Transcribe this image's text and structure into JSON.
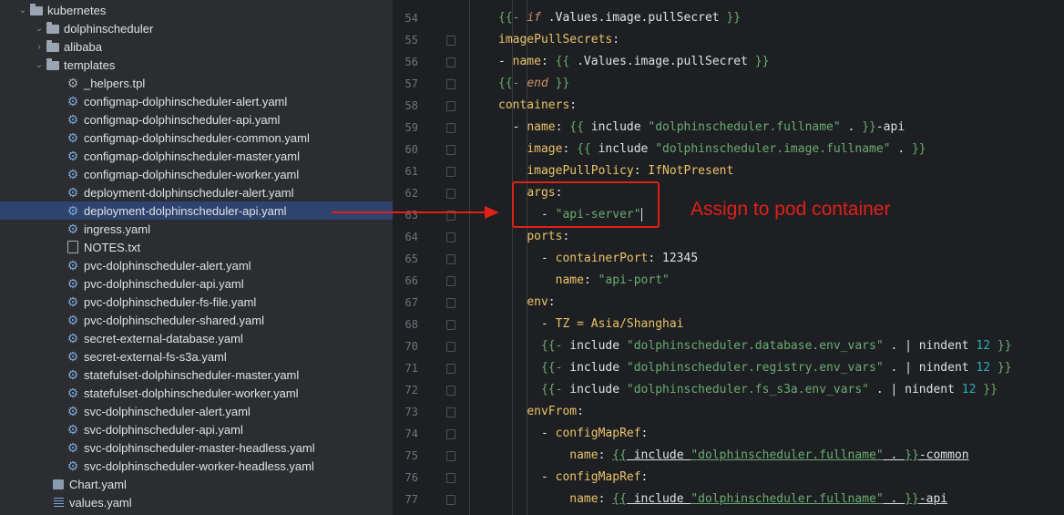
{
  "tree": {
    "items": [
      {
        "label": "kubernetes",
        "icon": "folder-icon"
      },
      {
        "label": "dolphinscheduler",
        "icon": "folder-icon"
      },
      {
        "label": "alibaba",
        "icon": "folder-icon"
      },
      {
        "label": "templates",
        "icon": "folder-icon"
      },
      {
        "label": "_helpers.tpl",
        "icon": "gear-icon"
      },
      {
        "label": "configmap-dolphinscheduler-alert.yaml",
        "icon": "gear-icon"
      },
      {
        "label": "configmap-dolphinscheduler-api.yaml",
        "icon": "gear-icon"
      },
      {
        "label": "configmap-dolphinscheduler-common.yaml",
        "icon": "gear-icon"
      },
      {
        "label": "configmap-dolphinscheduler-master.yaml",
        "icon": "gear-icon"
      },
      {
        "label": "configmap-dolphinscheduler-worker.yaml",
        "icon": "gear-icon"
      },
      {
        "label": "deployment-dolphinscheduler-alert.yaml",
        "icon": "gear-icon"
      },
      {
        "label": "deployment-dolphinscheduler-api.yaml",
        "icon": "gear-icon"
      },
      {
        "label": "ingress.yaml",
        "icon": "gear-icon"
      },
      {
        "label": "NOTES.txt",
        "icon": "text-file-icon"
      },
      {
        "label": "pvc-dolphinscheduler-alert.yaml",
        "icon": "gear-icon"
      },
      {
        "label": "pvc-dolphinscheduler-api.yaml",
        "icon": "gear-icon"
      },
      {
        "label": "pvc-dolphinscheduler-fs-file.yaml",
        "icon": "gear-icon"
      },
      {
        "label": "pvc-dolphinscheduler-shared.yaml",
        "icon": "gear-icon"
      },
      {
        "label": "secret-external-database.yaml",
        "icon": "gear-icon"
      },
      {
        "label": "secret-external-fs-s3a.yaml",
        "icon": "gear-icon"
      },
      {
        "label": "statefulset-dolphinscheduler-master.yaml",
        "icon": "gear-icon"
      },
      {
        "label": "statefulset-dolphinscheduler-worker.yaml",
        "icon": "gear-icon"
      },
      {
        "label": "svc-dolphinscheduler-alert.yaml",
        "icon": "gear-icon"
      },
      {
        "label": "svc-dolphinscheduler-api.yaml",
        "icon": "gear-icon"
      },
      {
        "label": "svc-dolphinscheduler-master-headless.yaml",
        "icon": "gear-icon"
      },
      {
        "label": "svc-dolphinscheduler-worker-headless.yaml",
        "icon": "gear-icon"
      },
      {
        "label": "Chart.yaml",
        "icon": "chart-file-icon"
      },
      {
        "label": "values.yaml",
        "icon": "list-file-icon"
      }
    ],
    "selected": "deployment-dolphinscheduler-api.yaml"
  },
  "editor": {
    "lines": [
      {
        "n": "54",
        "tokens": [
          {
            "c": "br",
            "t": "{{- "
          },
          {
            "c": "i",
            "t": "if"
          },
          {
            "c": "p",
            "t": " .Values.image.pullSecret "
          },
          {
            "c": "br",
            "t": "}}"
          }
        ]
      },
      {
        "n": "55",
        "tokens": [
          {
            "c": "t",
            "t": "imagePullSecrets"
          },
          {
            "c": "p",
            "t": ":"
          }
        ]
      },
      {
        "n": "56",
        "tokens": [
          {
            "c": "p",
            "t": "- "
          },
          {
            "c": "t",
            "t": "name"
          },
          {
            "c": "p",
            "t": ": "
          },
          {
            "c": "br",
            "t": "{{"
          },
          {
            "c": "p",
            "t": " .Values.image.pullSecret "
          },
          {
            "c": "br",
            "t": "}}"
          }
        ]
      },
      {
        "n": "57",
        "tokens": [
          {
            "c": "br",
            "t": "{{- "
          },
          {
            "c": "i",
            "t": "end"
          },
          {
            "c": "br",
            "t": " }}"
          }
        ]
      },
      {
        "n": "58",
        "tokens": [
          {
            "c": "t",
            "t": "containers"
          },
          {
            "c": "p",
            "t": ":"
          }
        ]
      },
      {
        "n": "59",
        "tokens": [
          {
            "c": "p",
            "t": "  - "
          },
          {
            "c": "t",
            "t": "name"
          },
          {
            "c": "p",
            "t": ": "
          },
          {
            "c": "br",
            "t": "{{"
          },
          {
            "c": "p",
            "t": " include "
          },
          {
            "c": "s",
            "t": "\"dolphinscheduler.fullname\""
          },
          {
            "c": "p",
            "t": " . "
          },
          {
            "c": "br",
            "t": "}}"
          },
          {
            "c": "p",
            "t": "-api"
          }
        ]
      },
      {
        "n": "60",
        "tokens": [
          {
            "c": "p",
            "t": "    "
          },
          {
            "c": "t",
            "t": "image"
          },
          {
            "c": "p",
            "t": ": "
          },
          {
            "c": "br",
            "t": "{{"
          },
          {
            "c": "p",
            "t": " include "
          },
          {
            "c": "s",
            "t": "\"dolphinscheduler.image.fullname\""
          },
          {
            "c": "p",
            "t": " . "
          },
          {
            "c": "br",
            "t": "}}"
          }
        ]
      },
      {
        "n": "61",
        "tokens": [
          {
            "c": "p",
            "t": "    "
          },
          {
            "c": "t",
            "t": "imagePullPolicy"
          },
          {
            "c": "p",
            "t": ": "
          },
          {
            "c": "t",
            "t": "IfNotPresent"
          }
        ]
      },
      {
        "n": "62",
        "tokens": [
          {
            "c": "p",
            "t": "    "
          },
          {
            "c": "t",
            "t": "args"
          },
          {
            "c": "p",
            "t": ":"
          }
        ]
      },
      {
        "n": "63",
        "tokens": [
          {
            "c": "p",
            "t": "      - "
          },
          {
            "c": "s",
            "t": "\"api-server\""
          }
        ]
      },
      {
        "n": "64",
        "tokens": [
          {
            "c": "p",
            "t": "    "
          },
          {
            "c": "t",
            "t": "ports"
          },
          {
            "c": "p",
            "t": ":"
          }
        ]
      },
      {
        "n": "65",
        "tokens": [
          {
            "c": "p",
            "t": "      - "
          },
          {
            "c": "t",
            "t": "containerPort"
          },
          {
            "c": "p",
            "t": ": 12345"
          }
        ]
      },
      {
        "n": "66",
        "tokens": [
          {
            "c": "p",
            "t": "        "
          },
          {
            "c": "t",
            "t": "name"
          },
          {
            "c": "p",
            "t": ": "
          },
          {
            "c": "s",
            "t": "\"api-port\""
          }
        ]
      },
      {
        "n": "67",
        "tokens": [
          {
            "c": "p",
            "t": "    "
          },
          {
            "c": "t",
            "t": "env"
          },
          {
            "c": "p",
            "t": ":"
          }
        ]
      },
      {
        "n": "68",
        "tokens": [
          {
            "c": "p",
            "t": "      - "
          },
          {
            "c": "t",
            "t": "TZ = Asia/Shanghai"
          }
        ]
      },
      {
        "n": "70",
        "tokens": [
          {
            "c": "p",
            "t": "      "
          },
          {
            "c": "br",
            "t": "{{-"
          },
          {
            "c": "p",
            "t": " include "
          },
          {
            "c": "s",
            "t": "\"dolphinscheduler.database.env_vars\""
          },
          {
            "c": "p",
            "t": " . | nindent "
          },
          {
            "c": "n",
            "t": "12"
          },
          {
            "c": "br",
            "t": " }}"
          }
        ]
      },
      {
        "n": "71",
        "tokens": [
          {
            "c": "p",
            "t": "      "
          },
          {
            "c": "br",
            "t": "{{-"
          },
          {
            "c": "p",
            "t": " include "
          },
          {
            "c": "s",
            "t": "\"dolphinscheduler.registry.env_vars\""
          },
          {
            "c": "p",
            "t": " . | nindent "
          },
          {
            "c": "n",
            "t": "12"
          },
          {
            "c": "br",
            "t": " }}"
          }
        ]
      },
      {
        "n": "72",
        "tokens": [
          {
            "c": "p",
            "t": "      "
          },
          {
            "c": "br",
            "t": "{{-"
          },
          {
            "c": "p",
            "t": " include "
          },
          {
            "c": "s",
            "t": "\"dolphinscheduler.fs_s3a.env_vars\""
          },
          {
            "c": "p",
            "t": " . | nindent "
          },
          {
            "c": "n",
            "t": "12"
          },
          {
            "c": "br",
            "t": " }}"
          }
        ]
      },
      {
        "n": "73",
        "tokens": [
          {
            "c": "p",
            "t": "    "
          },
          {
            "c": "t",
            "t": "envFrom"
          },
          {
            "c": "p",
            "t": ":"
          }
        ]
      },
      {
        "n": "74",
        "tokens": [
          {
            "c": "p",
            "t": "      - "
          },
          {
            "c": "t",
            "t": "configMapRef"
          },
          {
            "c": "p",
            "t": ":"
          }
        ]
      },
      {
        "n": "75",
        "tokens": [
          {
            "c": "p",
            "t": "          "
          },
          {
            "c": "t",
            "t": "name"
          },
          {
            "c": "p",
            "t": ": "
          },
          {
            "c": "br u",
            "t": "{{"
          },
          {
            "c": "p u",
            "t": " include "
          },
          {
            "c": "s u",
            "t": "\"dolphinscheduler.fullname\""
          },
          {
            "c": "p u",
            "t": " . "
          },
          {
            "c": "br u",
            "t": "}}"
          },
          {
            "c": "p u",
            "t": "-common"
          }
        ]
      },
      {
        "n": "76",
        "tokens": [
          {
            "c": "p",
            "t": "      - "
          },
          {
            "c": "t",
            "t": "configMapRef"
          },
          {
            "c": "p",
            "t": ":"
          }
        ]
      },
      {
        "n": "77",
        "tokens": [
          {
            "c": "p",
            "t": "          "
          },
          {
            "c": "t",
            "t": "name"
          },
          {
            "c": "p",
            "t": ": "
          },
          {
            "c": "br u",
            "t": "{{"
          },
          {
            "c": "p u",
            "t": " include "
          },
          {
            "c": "s u",
            "t": "\"dolphinscheduler.fullname\""
          },
          {
            "c": "p u",
            "t": " . "
          },
          {
            "c": "br u",
            "t": "}}"
          },
          {
            "c": "p u",
            "t": "-api"
          }
        ]
      }
    ]
  },
  "annotation": {
    "text": "Assign to pod container",
    "color": "#e0201b"
  }
}
